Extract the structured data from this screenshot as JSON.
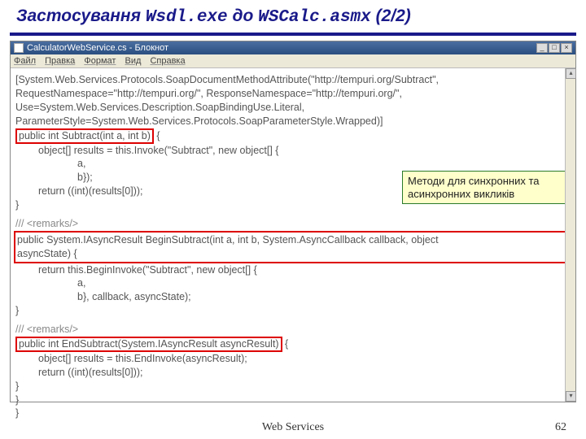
{
  "title": {
    "pre": "Застосування ",
    "mono1": "Wsdl.exe",
    "mid": " до ",
    "mono2": "WSCalc.asmx",
    "suffix": "   (2/2)"
  },
  "window": {
    "caption": "CalculatorWebService.cs - Блокнот",
    "menu": {
      "file": "Файл",
      "edit": "Правка",
      "format": "Формат",
      "view": "Вид",
      "help": "Справка"
    }
  },
  "code": {
    "l1": "[System.Web.Services.Protocols.SoapDocumentMethodAttribute(\"http://tempuri.org/Subtract\",",
    "l2": "RequestNamespace=\"http://tempuri.org/\", ResponseNamespace=\"http://tempuri.org/\",",
    "l3": "Use=System.Web.Services.Description.SoapBindingUse.Literal,",
    "l4": "ParameterStyle=System.Web.Services.Protocols.SoapParameterStyle.Wrapped)]",
    "sig1": "public int Subtract(int a, int b)",
    "brace_open": " {",
    "l6": "object[] results = this.Invoke(\"Subtract\", new object[] {",
    "l7": "a,",
    "l8": "b});",
    "l9": "return ((int)(results[0]));",
    "brace_close": "}",
    "rem": "/// <remarks/>",
    "sig2a": "public System.IAsyncResult BeginSubtract(int a, int b, System.AsyncCallback callback, object",
    "sig2b": "asyncState) {",
    "l13": "return this.BeginInvoke(\"Subtract\", new object[] {",
    "l14": "a,",
    "l15": "b}, callback, asyncState);",
    "sig3": "public int EndSubtract(System.IAsyncResult asyncResult)",
    "l18": "object[] results = this.EndInvoke(asyncResult);",
    "l19": "return ((int)(results[0]));"
  },
  "callout": "Методи для синхронних та асинхронних викликів",
  "footer": {
    "label": "Web Services",
    "page": "62"
  }
}
